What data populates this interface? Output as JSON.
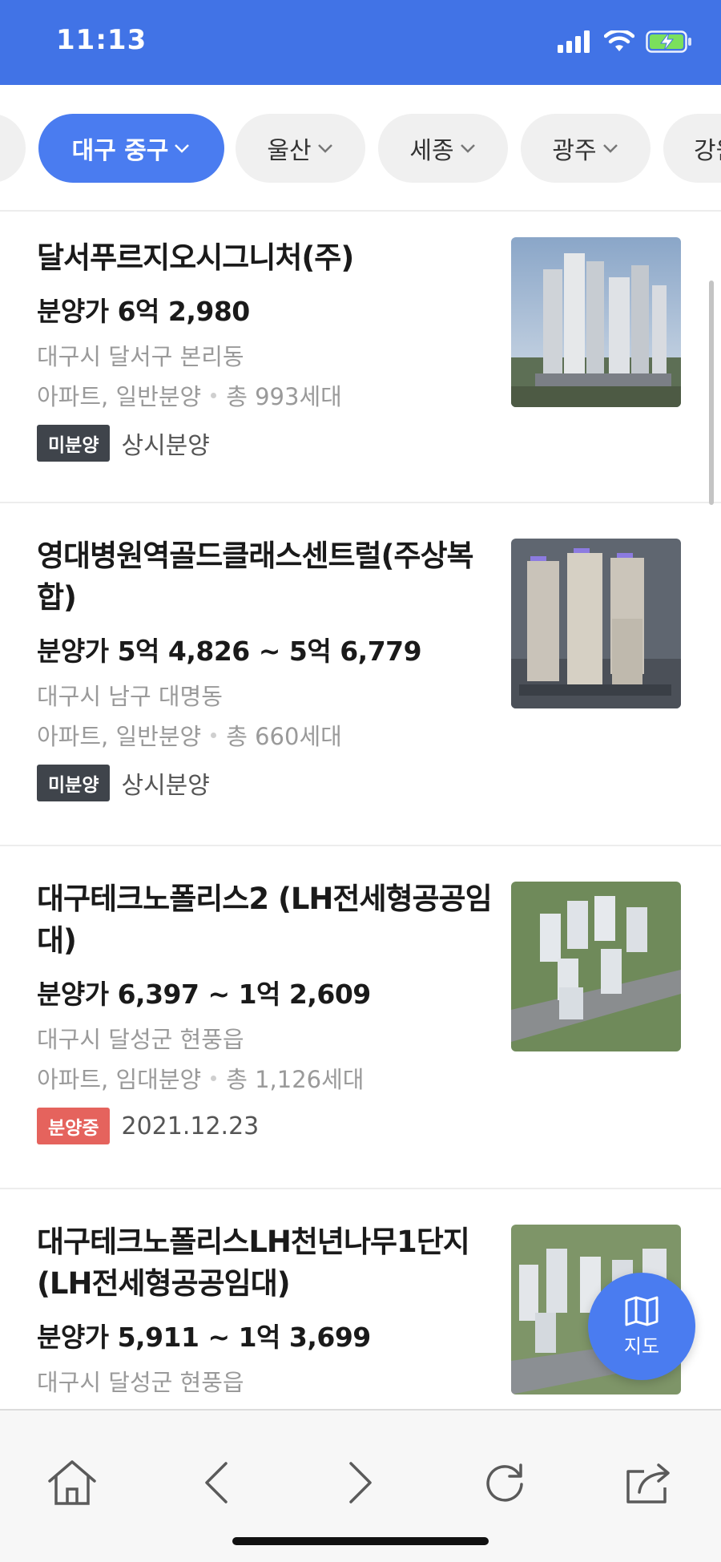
{
  "status_bar": {
    "time": "11:13",
    "icons": [
      "signal-icon",
      "wifi-icon",
      "battery-charging-icon"
    ],
    "color": "#4173e6"
  },
  "regions": [
    {
      "label": "대구 중구",
      "active": true
    },
    {
      "label": "울산",
      "active": false
    },
    {
      "label": "세종",
      "active": false
    },
    {
      "label": "광주",
      "active": false
    },
    {
      "label": "강원",
      "active": false
    }
  ],
  "listings": [
    {
      "title": "달서푸르지오시그니처(주)",
      "price": "분양가 6억 2,980",
      "location": "대구시 달서구 본리동",
      "type": "아파트, 일반분양",
      "units": "총 993세대",
      "badge": "미분양",
      "badge_color": "#3f444b",
      "status": "상시분양",
      "image": "apartment-rendering"
    },
    {
      "title": "영대병원역골드클래스센트럴(주상복합)",
      "price": "분양가 5억 4,826 ~ 5억 6,779",
      "location": "대구시 남구 대명동",
      "type": "아파트, 일반분양",
      "units": "총 660세대",
      "badge": "미분양",
      "badge_color": "#3f444b",
      "status": "상시분양",
      "image": "apartment-rendering"
    },
    {
      "title": "대구테크노폴리스2 (LH전세형공공임대)",
      "price": "분양가 6,397 ~ 1억 2,609",
      "location": "대구시 달성군 현풍읍",
      "type": "아파트, 임대분양",
      "units": "총 1,126세대",
      "badge": "분양중",
      "badge_color": "#e5635d",
      "status": "2021.12.23",
      "image": "apartment-rendering"
    },
    {
      "title": "대구테크노폴리스LH천년나무1단지(LH전세형공공임대)",
      "price": "분양가 5,911 ~ 1억 3,699",
      "location": "대구시 달성군 현풍읍",
      "image": "apartment-rendering"
    }
  ],
  "map_button": {
    "label": "지도",
    "icon": "map-icon"
  },
  "toolbar": {
    "icons": [
      "home-icon",
      "back-icon",
      "forward-icon",
      "refresh-icon",
      "share-icon"
    ]
  },
  "accent_color": "#4a7cf0"
}
